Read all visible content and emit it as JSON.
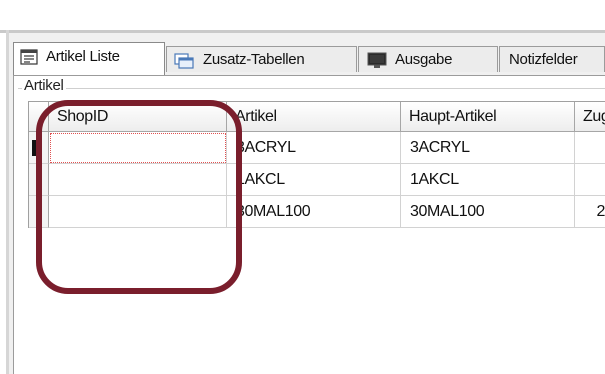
{
  "tabs": [
    {
      "label": "Artikel Liste",
      "icon": "list-icon",
      "active": true
    },
    {
      "label": "Zusatz-Tabellen",
      "icon": "windows-icon",
      "active": false
    },
    {
      "label": "Ausgabe",
      "icon": "monitor-icon",
      "active": false
    },
    {
      "label": "Notizfelder",
      "icon": "",
      "active": false
    }
  ],
  "group": {
    "label": "Artikel"
  },
  "grid": {
    "columns": [
      "ShopID",
      "Artikel",
      "Haupt-Artikel",
      "Zug"
    ],
    "rows": [
      {
        "ShopID": "",
        "Artikel": "3ACRYL",
        "HauptArtikel": "3ACRYL",
        "Zug": "",
        "current": true
      },
      {
        "ShopID": "",
        "Artikel": "1AKCL",
        "HauptArtikel": "1AKCL",
        "Zug": ""
      },
      {
        "ShopID": "",
        "Artikel": "30MAL100",
        "HauptArtikel": "30MAL100",
        "Zug": "2"
      }
    ]
  },
  "colors": {
    "annotation": "#7a1e2c",
    "focus_outline": "#e05050"
  }
}
